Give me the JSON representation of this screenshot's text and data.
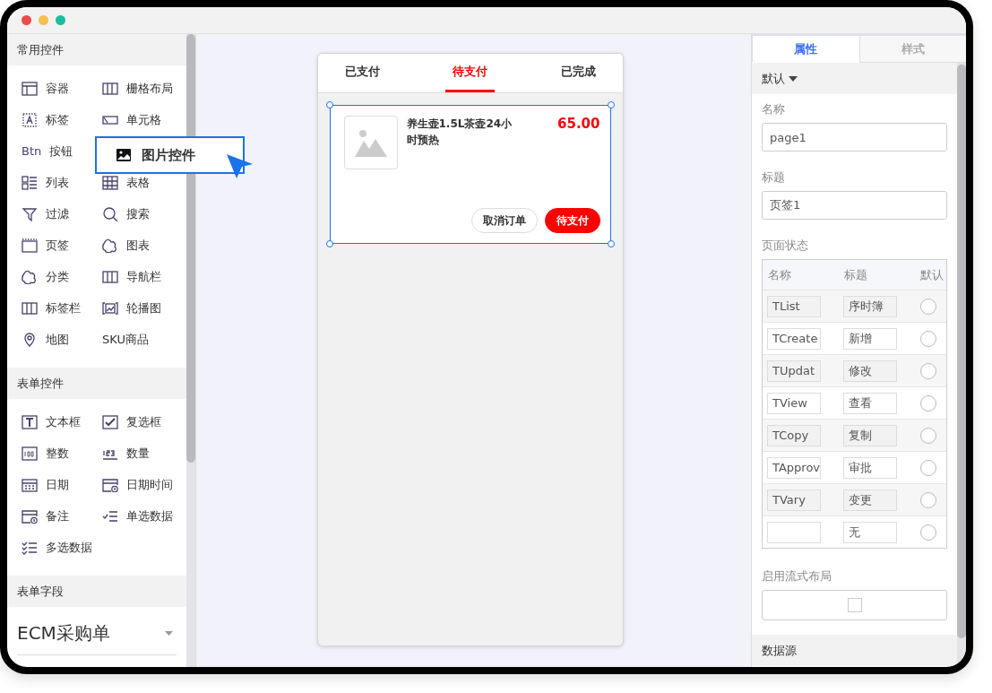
{
  "sidebar": {
    "sections": [
      {
        "title": "常用控件",
        "items": [
          {
            "label": "容器"
          },
          {
            "label": "栅格布局"
          },
          {
            "label": "标签"
          },
          {
            "label": "单元格"
          },
          {
            "label": "按钮",
            "prefix": "Btn"
          },
          {
            "label": "列表"
          },
          {
            "label": "表格"
          },
          {
            "label": "过滤"
          },
          {
            "label": "搜索"
          },
          {
            "label": "页签"
          },
          {
            "label": "图表"
          },
          {
            "label": "分类"
          },
          {
            "label": "导航栏"
          },
          {
            "label": "标签栏"
          },
          {
            "label": "轮播图"
          },
          {
            "label": "地图"
          },
          {
            "label": "SKU商品"
          }
        ]
      },
      {
        "title": "表单控件",
        "items": [
          {
            "label": "文本框"
          },
          {
            "label": "复选框"
          },
          {
            "label": "整数"
          },
          {
            "label": "数量"
          },
          {
            "label": "日期"
          },
          {
            "label": "日期时间"
          },
          {
            "label": "备注"
          },
          {
            "label": "单选数据"
          },
          {
            "label": "多选数据"
          }
        ]
      },
      {
        "title": "表单字段"
      }
    ],
    "form_select": {
      "value": "ECM采购单"
    }
  },
  "drag_item": {
    "label": "图片控件"
  },
  "phone": {
    "tabs": [
      {
        "label": "已支付",
        "selected": false
      },
      {
        "label": "待支付",
        "selected": true
      },
      {
        "label": "已完成",
        "selected": false
      }
    ],
    "order": {
      "title": "养生壶1.5L茶壶24小时预热",
      "price": "65.00",
      "selected": true,
      "buttons": [
        {
          "label": "取消订单",
          "kind": "outline"
        },
        {
          "label": "待支付",
          "kind": "primary"
        }
      ]
    }
  },
  "panel": {
    "tabs": [
      {
        "label": "属性",
        "selected": true
      },
      {
        "label": "样式",
        "selected": false
      }
    ],
    "group": "默认",
    "fields": [
      {
        "label": "名称",
        "value": "page1"
      },
      {
        "label": "标题",
        "value": "页签1"
      }
    ],
    "states": {
      "title": "页面状态",
      "columns": [
        "名称",
        "标题",
        "默认"
      ],
      "rows": [
        {
          "name": "TList",
          "title": "序时簿",
          "selected": false
        },
        {
          "name": "TCreate",
          "title": "新增",
          "selected": false
        },
        {
          "name": "TUpdat",
          "title": "修改",
          "selected": false
        },
        {
          "name": "TView",
          "title": "查看",
          "selected": false
        },
        {
          "name": "TCopy",
          "title": "复制",
          "selected": false
        },
        {
          "name": "TApprov",
          "title": "审批",
          "selected": false
        },
        {
          "name": "TVary",
          "title": "变更",
          "selected": false
        },
        {
          "name": "",
          "title": "无",
          "selected": false
        }
      ]
    },
    "flow": {
      "label": "启用流式布局",
      "checked": false
    },
    "datasource": "数据源"
  }
}
